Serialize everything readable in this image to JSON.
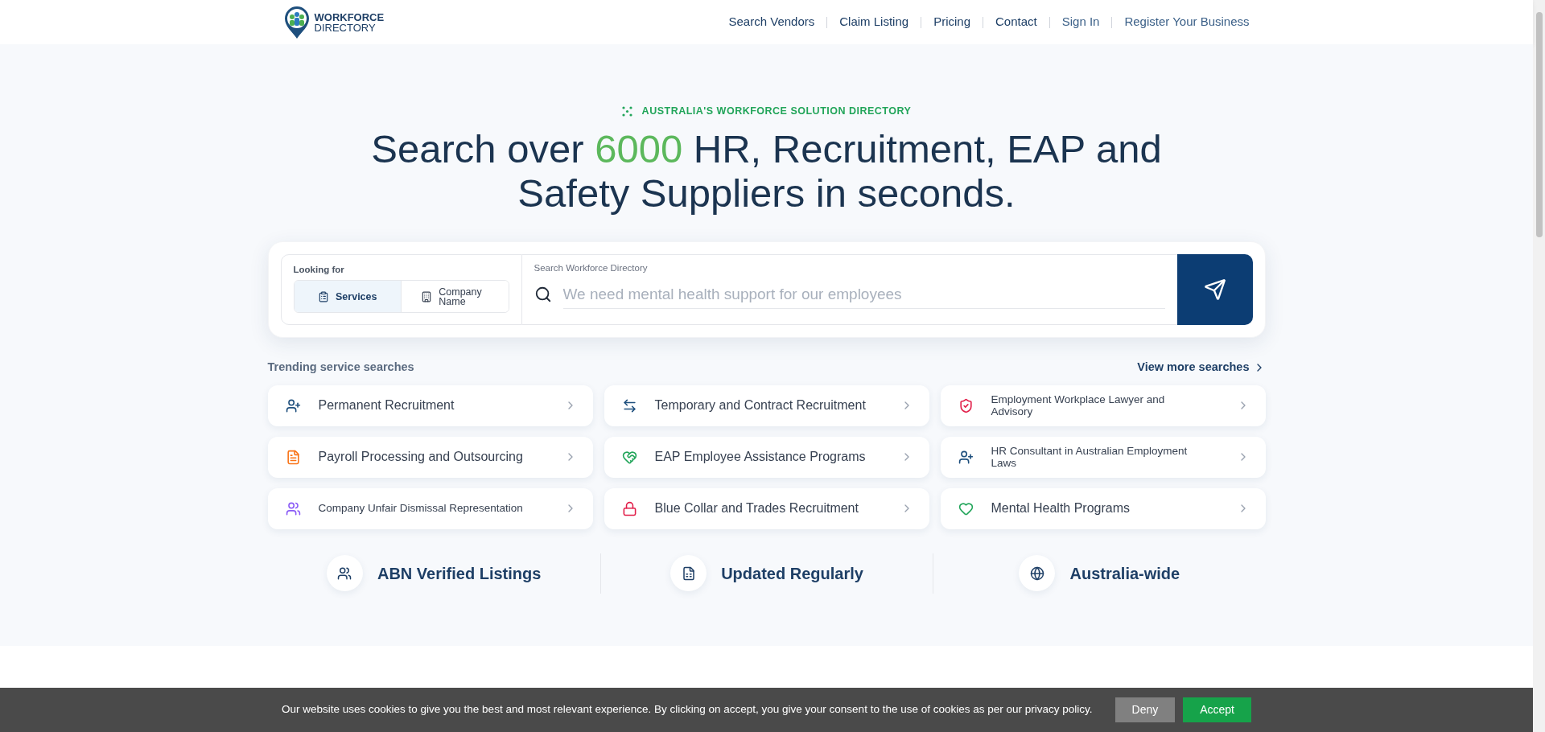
{
  "header": {
    "logo_line_1": "WORKFORCE",
    "logo_line_2": "DIRECTORY",
    "nav": [
      "Search Vendors",
      "Claim Listing",
      "Pricing",
      "Contact",
      "Sign In",
      "Register Your Business"
    ]
  },
  "hero": {
    "eyebrow": "AUSTRALIA'S WORKFORCE SOLUTION DIRECTORY",
    "heading_before": "Search over ",
    "heading_highlight": "6000",
    "heading_after": " HR, Recruitment, EAP and Safety Suppliers in seconds."
  },
  "search": {
    "looking_for_label": "Looking for",
    "tabs": [
      {
        "label": "Services",
        "selected": true
      },
      {
        "label": "Company Name",
        "selected": false
      }
    ],
    "field_label": "Search Workforce Directory",
    "placeholder": "We need mental health support for our employees"
  },
  "trending": {
    "title": "Trending service searches",
    "more_link": "View more searches",
    "items": [
      {
        "label": "Permanent Recruitment",
        "color": "#1e4f7d"
      },
      {
        "label": "Temporary and Contract Recruitment",
        "color": "#1e4f7d"
      },
      {
        "label": "Employment Workplace Lawyer and Advisory",
        "color": "#e11d48"
      },
      {
        "label": "Payroll Processing and Outsourcing",
        "color": "#f97316"
      },
      {
        "label": "EAP Employee Assistance Programs",
        "color": "#22a55a"
      },
      {
        "label": "HR Consultant in Australian Employment Laws",
        "color": "#1e4f7d"
      },
      {
        "label": "Company Unfair Dismissal Representation",
        "color": "#8b5cf6"
      },
      {
        "label": "Blue Collar and Trades Recruitment",
        "color": "#e11d48"
      },
      {
        "label": "Mental Health Programs",
        "color": "#22a55a"
      }
    ]
  },
  "features": [
    "ABN Verified Listings",
    "Updated Regularly",
    "Australia-wide"
  ],
  "cookie_bar": {
    "message": "Our website uses cookies to give you the best and most relevant experience. By clicking on accept, you give your consent to the use of cookies as per our privacy policy.",
    "buttons": [
      "Deny",
      "Accept"
    ]
  }
}
